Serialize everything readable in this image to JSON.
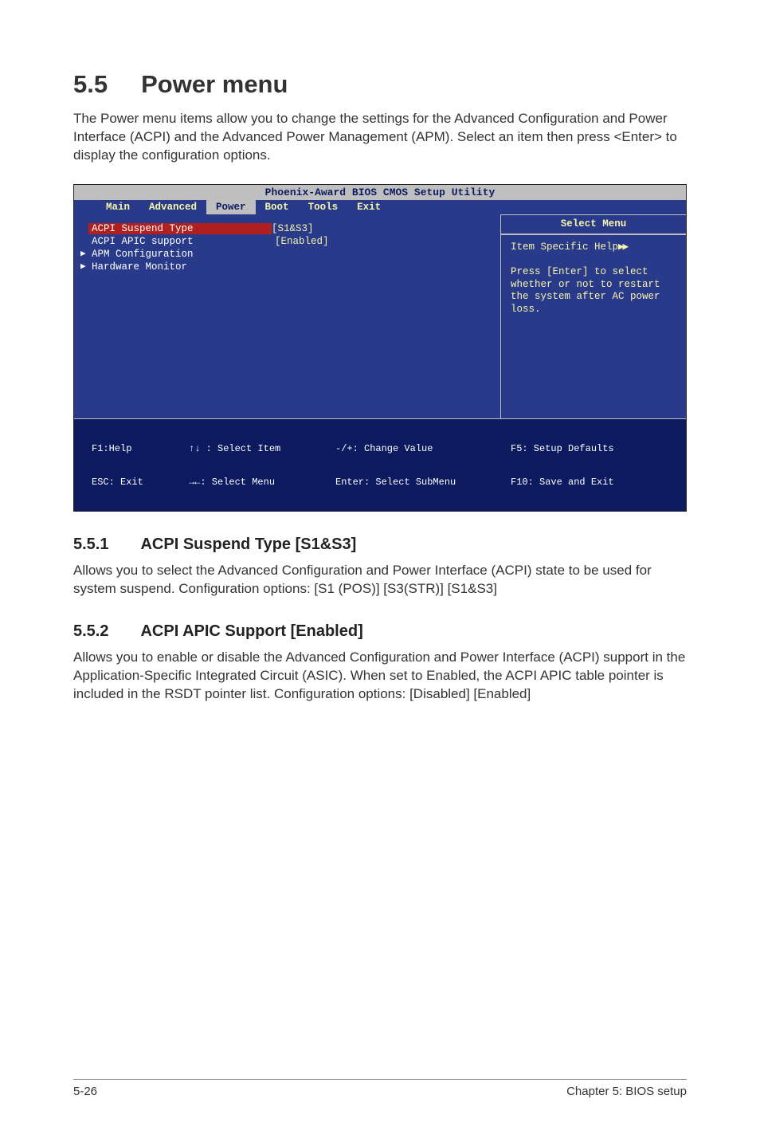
{
  "section": {
    "number": "5.5",
    "title": "Power menu",
    "intro": "The Power menu items allow you to change the settings for the Advanced Configuration and Power Interface (ACPI) and the Advanced Power Management (APM). Select an item then press <Enter> to display the configuration options."
  },
  "bios": {
    "window_title": "Phoenix-Award BIOS CMOS Setup Utility",
    "menubar": [
      "Main",
      "Advanced",
      "Power",
      "Boot",
      "Tools",
      "Exit"
    ],
    "selected_menu_index": 2,
    "left_items": [
      {
        "label": "ACPI Suspend Type",
        "value": "[S1&S3]",
        "selected": true,
        "submenu": false
      },
      {
        "label": "ACPI APIC support",
        "value": "[Enabled]",
        "selected": false,
        "submenu": false
      },
      {
        "label": "APM Configuration",
        "value": "",
        "selected": false,
        "submenu": true
      },
      {
        "label": "Hardware Monitor",
        "value": "",
        "selected": false,
        "submenu": true
      }
    ],
    "right": {
      "header": "Select Menu",
      "help_label": "Item Specific Help",
      "help_arrows": "▶▶",
      "help_body": "Press [Enter] to select whether or not to restart the system after AC power loss."
    },
    "footer": {
      "f1": "F1:Help",
      "esc": "ESC: Exit",
      "updown": "↑↓ : Select Item",
      "leftright": "→←: Select Menu",
      "pm": "-/+: Change Value",
      "enter": "Enter: Select SubMenu",
      "f5": "F5: Setup Defaults",
      "f10": "F10: Save and Exit"
    }
  },
  "sub1": {
    "number": "5.5.1",
    "title": "ACPI Suspend Type [S1&S3]",
    "body": "Allows you to select the Advanced Configuration and Power Interface (ACPI) state to be used for system suspend. Configuration options: [S1 (POS)] [S3(STR)] [S1&S3]"
  },
  "sub2": {
    "number": "5.5.2",
    "title": "ACPI APIC Support [Enabled]",
    "body": "Allows you to enable or disable the Advanced Configuration and Power Interface (ACPI) support in the Application-Specific Integrated Circuit (ASIC). When set to Enabled, the ACPI APIC table pointer is included in the RSDT pointer list. Configuration options: [Disabled] [Enabled]"
  },
  "page_footer": {
    "left": "5-26",
    "right": "Chapter 5: BIOS setup"
  }
}
